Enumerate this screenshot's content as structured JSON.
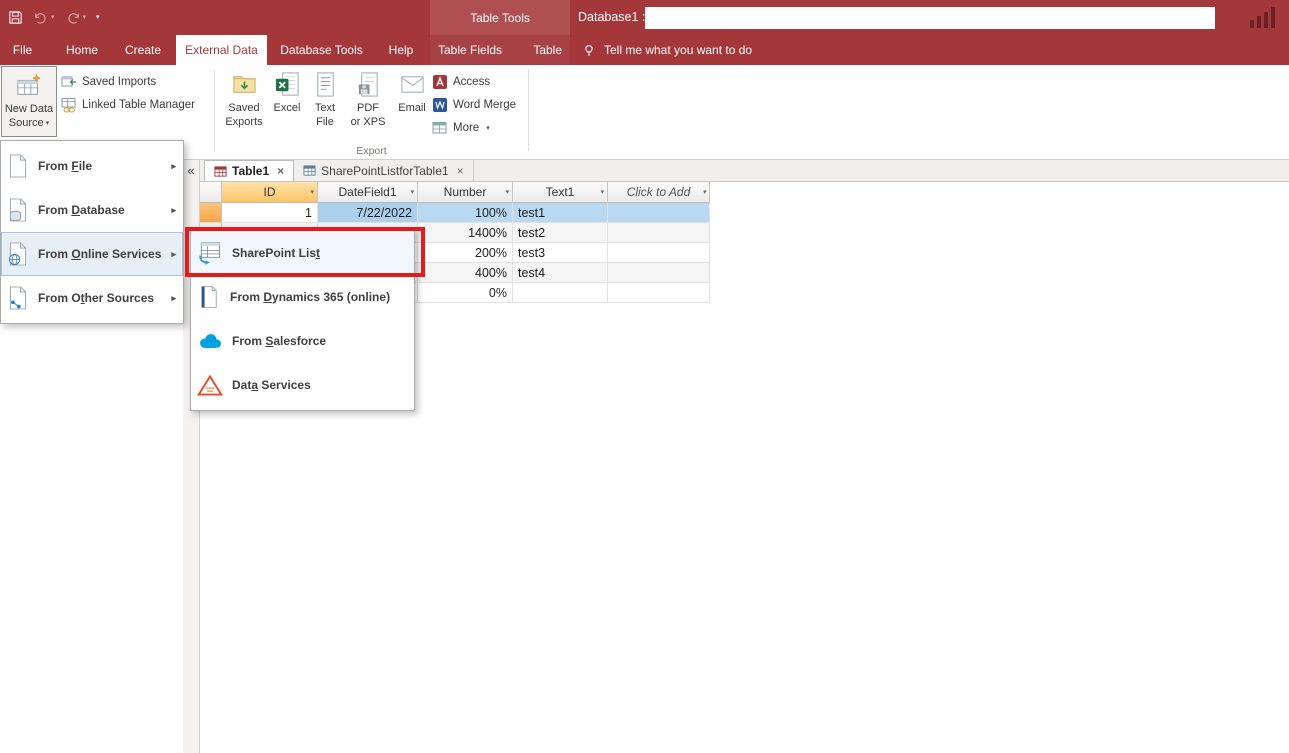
{
  "colors": {
    "accent": "#A4373A",
    "selection_blue": "#B9D8F2",
    "row_indicator_orange": "#F8A44A",
    "annotation_red": "#E21B1B"
  },
  "icons": {
    "caret": "▾",
    "submenu_arrow": "▸",
    "collapse_left": "«",
    "close": "×",
    "header_dd": "▾"
  },
  "titlebar": {
    "contextual_label": "Table Tools",
    "database_label": "Database1 :"
  },
  "tabs": {
    "file": "File",
    "home": "Home",
    "create": "Create",
    "external_data": "External Data",
    "database_tools": "Database Tools",
    "help": "Help",
    "table_fields": "Table Fields",
    "table": "Table",
    "tell_me": "Tell me what you want to do"
  },
  "ribbon": {
    "new_data_source": "New Data\nSource",
    "saved_imports": "Saved Imports",
    "linked_table_manager": "Linked Table Manager",
    "saved_exports": "Saved\nExports",
    "excel": "Excel",
    "text_file": "Text\nFile",
    "pdf_or_xps": "PDF\nor XPS",
    "email": "Email",
    "access": "Access",
    "word_merge": "Word Merge",
    "more": "More",
    "export_group": "Export"
  },
  "menu": {
    "items": [
      {
        "pre": "From ",
        "key": "F",
        "post": "ile"
      },
      {
        "pre": "From ",
        "key": "D",
        "post": "atabase"
      },
      {
        "pre": "From ",
        "key": "O",
        "post": "nline Services"
      },
      {
        "pre": "From O",
        "key": "t",
        "post": "her Sources"
      }
    ]
  },
  "submenu": {
    "items": [
      {
        "pre": "SharePoint Lis",
        "key": "t",
        "post": ""
      },
      {
        "pre": "From ",
        "key": "D",
        "post": "ynamics 365 (online)"
      },
      {
        "pre": "From ",
        "key": "S",
        "post": "alesforce"
      },
      {
        "pre": "Dat",
        "key": "a",
        "post": " Services"
      }
    ]
  },
  "doc_tabs": {
    "table1": "Table1",
    "sharepoint": "SharePointListforTable1"
  },
  "datasheet": {
    "columns": [
      "ID",
      "DateField1",
      "Number",
      "Text1",
      "Click to Add"
    ],
    "rows": [
      {
        "id": "1",
        "date": "7/22/2022",
        "number": "100%",
        "text": "test1"
      },
      {
        "id": "",
        "date": "",
        "number": "1400%",
        "text": "test2"
      },
      {
        "id": "",
        "date": "",
        "number": "200%",
        "text": "test3"
      },
      {
        "id": "",
        "date": "",
        "number": "400%",
        "text": "test4"
      },
      {
        "id": "",
        "date": "",
        "number": "0%",
        "text": ""
      }
    ]
  }
}
